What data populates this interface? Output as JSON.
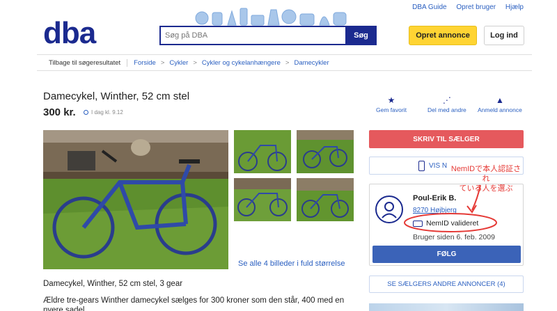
{
  "header": {
    "top_links": [
      "DBA Guide",
      "Opret bruger",
      "Hjælp"
    ],
    "logo_text": "dba",
    "search_placeholder": "Søg på DBA",
    "search_button": "Søg",
    "create_button": "Opret annonce",
    "login_button": "Log ind",
    "brand_color": "#1b2a8f",
    "accent_yellow": "#ffd433"
  },
  "breadcrumb": {
    "back": "Tilbage til søgeresultatet",
    "items": [
      "Forside",
      "Cykler",
      "Cykler og cykelanhængere",
      "Damecykler"
    ],
    "separator": ">"
  },
  "listing": {
    "title": "Damecykel, Winther, 52 cm stel",
    "price": "300 kr.",
    "posted": "I dag kl. 9.12",
    "see_all": "Se alle 4 billeder i fuld størrelse",
    "description_line1": "Damecykel, Winther, 52 cm stel, 3 gear",
    "description_line2": "Ældre tre-gears Winther damecykel sælges for 300 kroner som den står, 400 med en nyere sadel"
  },
  "actions": [
    {
      "label": "Gem favorit",
      "icon": "star-icon"
    },
    {
      "label": "Del med andre",
      "icon": "share-icon"
    },
    {
      "label": "Anmeld annonce",
      "icon": "warning-icon"
    }
  ],
  "seller_panel": {
    "write_button": "SKRIV TIL SÆLGER",
    "show_number_button": "VIS N",
    "name": "Poul-Erik B.",
    "zip": "8270 Højbjerg",
    "nemid": "NemID valideret",
    "member_since": "Bruger siden 6. feb. 2009",
    "follow_button": "FØLG",
    "other_ads_button": "SE SÆLGERS ANDRE ANNONCER (4)",
    "write_color": "#e5595d",
    "follow_color": "#3b63b8"
  },
  "annotation": {
    "text_line1": "NemIDで本人認証され",
    "text_line2": "ている人を選ぶ",
    "color": "#e53935"
  }
}
